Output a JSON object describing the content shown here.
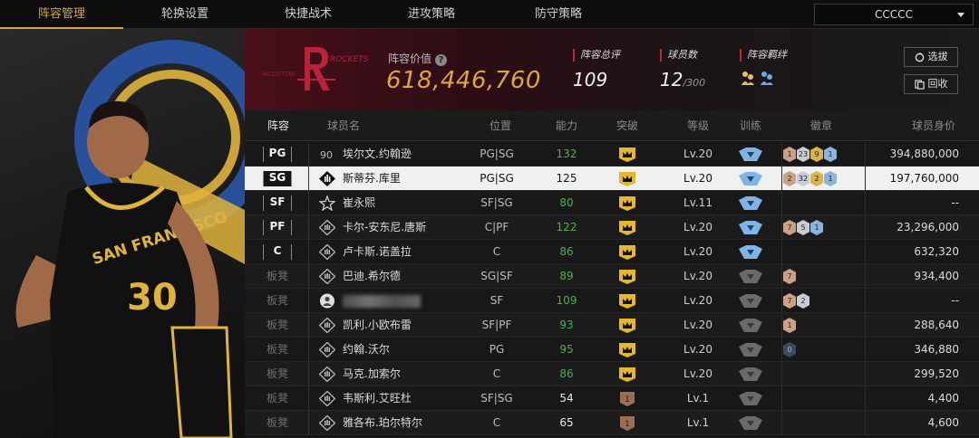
{
  "nav": {
    "tabs": [
      "阵容管理",
      "轮换设置",
      "快捷战术",
      "进攻策略",
      "防守策略"
    ],
    "active": 0,
    "team_select": "CCCCC"
  },
  "header": {
    "logo_text": "ROCKETS",
    "logo_side_text": "HOUSTON",
    "value_label": "阵容价值",
    "value": "618,446,760",
    "stats": [
      {
        "label": "阵容总评",
        "value": "109",
        "suffix": ""
      },
      {
        "label": "球员数",
        "value": "12",
        "suffix": "/300"
      },
      {
        "label": "阵容羁绊",
        "value": "",
        "suffix": ""
      }
    ],
    "select_button": "选拔",
    "recycle_button": "回收"
  },
  "columns": [
    "阵容",
    "球员名",
    "位置",
    "能力",
    "突破",
    "等级",
    "训练",
    "徽章",
    "球员身价"
  ],
  "accent_gold": "#d9a441",
  "rows": [
    {
      "slot": "PG",
      "starter": true,
      "icon": "90",
      "name": "埃尔文.约翰逊",
      "pos": "PG|SG",
      "ability": "132",
      "abilityColor": "green",
      "breakthrough": "crown",
      "level": "Lv.20",
      "training": "blue",
      "badges": [
        [
          "b-br",
          "1"
        ],
        [
          "b-sl",
          "23"
        ],
        [
          "b-gd",
          "9"
        ],
        [
          "b-bl",
          "1"
        ]
      ],
      "salary": "394,880,000"
    },
    {
      "slot": "SG",
      "starter": true,
      "selected": true,
      "icon": "diamond",
      "name": "斯蒂芬.库里",
      "pos": "PG|SG",
      "ability": "125",
      "abilityColor": "white",
      "breakthrough": "crown",
      "level": "Lv.20",
      "training": "blue",
      "badges": [
        [
          "b-br",
          "2"
        ],
        [
          "b-sl",
          "32"
        ],
        [
          "b-gd",
          "2"
        ],
        [
          "b-bl",
          "1"
        ]
      ],
      "salary": "197,760,000"
    },
    {
      "slot": "SF",
      "starter": true,
      "icon": "star",
      "name": "崔永熙",
      "pos": "SF|SG",
      "ability": "80",
      "abilityColor": "green",
      "breakthrough": "crown",
      "level": "Lv.11",
      "training": "blue",
      "badges": [],
      "salary": "--"
    },
    {
      "slot": "PF",
      "starter": true,
      "icon": "bars",
      "name": "卡尔-安东尼.唐斯",
      "pos": "C|PF",
      "ability": "122",
      "abilityColor": "green",
      "breakthrough": "crown",
      "level": "Lv.20",
      "training": "blue",
      "badges": [
        [
          "b-br",
          "7"
        ],
        [
          "b-sl",
          "5"
        ],
        [
          "b-bl",
          "1"
        ]
      ],
      "salary": "23,296,000"
    },
    {
      "slot": "C",
      "starter": true,
      "icon": "bars",
      "name": "卢卡斯.诺盖拉",
      "pos": "C",
      "ability": "86",
      "abilityColor": "green",
      "breakthrough": "crown",
      "level": "Lv.20",
      "training": "blue",
      "badges": [],
      "salary": "632,320"
    },
    {
      "slot": "板凳",
      "starter": false,
      "icon": "bars",
      "name": "巴迪.希尔德",
      "pos": "SG|SF",
      "ability": "89",
      "abilityColor": "green",
      "breakthrough": "crown",
      "level": "Lv.20",
      "training": "grey",
      "badges": [
        [
          "b-br",
          "7"
        ]
      ],
      "salary": "934,400"
    },
    {
      "slot": "板凳",
      "starter": false,
      "icon": "person",
      "name": "",
      "blurred": true,
      "pos": "SF",
      "ability": "109",
      "abilityColor": "green",
      "breakthrough": "crown",
      "level": "Lv.20",
      "training": "grey",
      "badges": [
        [
          "b-br",
          "7"
        ],
        [
          "b-sl",
          "2"
        ]
      ],
      "salary": "--"
    },
    {
      "slot": "板凳",
      "starter": false,
      "icon": "bars",
      "name": "凯利.小欧布雷",
      "pos": "SF|PF",
      "ability": "93",
      "abilityColor": "green",
      "breakthrough": "crown",
      "level": "Lv.20",
      "training": "grey",
      "badges": [
        [
          "b-br",
          "1"
        ]
      ],
      "salary": "288,640"
    },
    {
      "slot": "板凳",
      "starter": false,
      "icon": "bars",
      "name": "约翰.沃尔",
      "pos": "PG",
      "ability": "95",
      "abilityColor": "green",
      "breakthrough": "crown",
      "level": "Lv.20",
      "training": "grey",
      "badges": [
        [
          "b-dk",
          "0"
        ]
      ],
      "salary": "346,880"
    },
    {
      "slot": "板凳",
      "starter": false,
      "icon": "bars",
      "name": "马克.加索尔",
      "pos": "C",
      "ability": "86",
      "abilityColor": "green",
      "breakthrough": "crown",
      "level": "Lv.20",
      "training": "grey",
      "badges": [],
      "salary": "299,520"
    },
    {
      "slot": "板凳",
      "starter": false,
      "icon": "bars",
      "name": "韦斯利.艾旺杜",
      "pos": "SF|SG",
      "ability": "54",
      "abilityColor": "white",
      "breakthrough": "num1",
      "level": "Lv.1",
      "training": "grey",
      "badges": [],
      "salary": "4,400"
    },
    {
      "slot": "板凳",
      "starter": false,
      "icon": "bars",
      "name": "雅各布.珀尔特尔",
      "pos": "C",
      "ability": "65",
      "abilityColor": "white",
      "breakthrough": "num1",
      "level": "Lv.1",
      "training": "grey",
      "badges": [],
      "salary": "4,600"
    }
  ]
}
